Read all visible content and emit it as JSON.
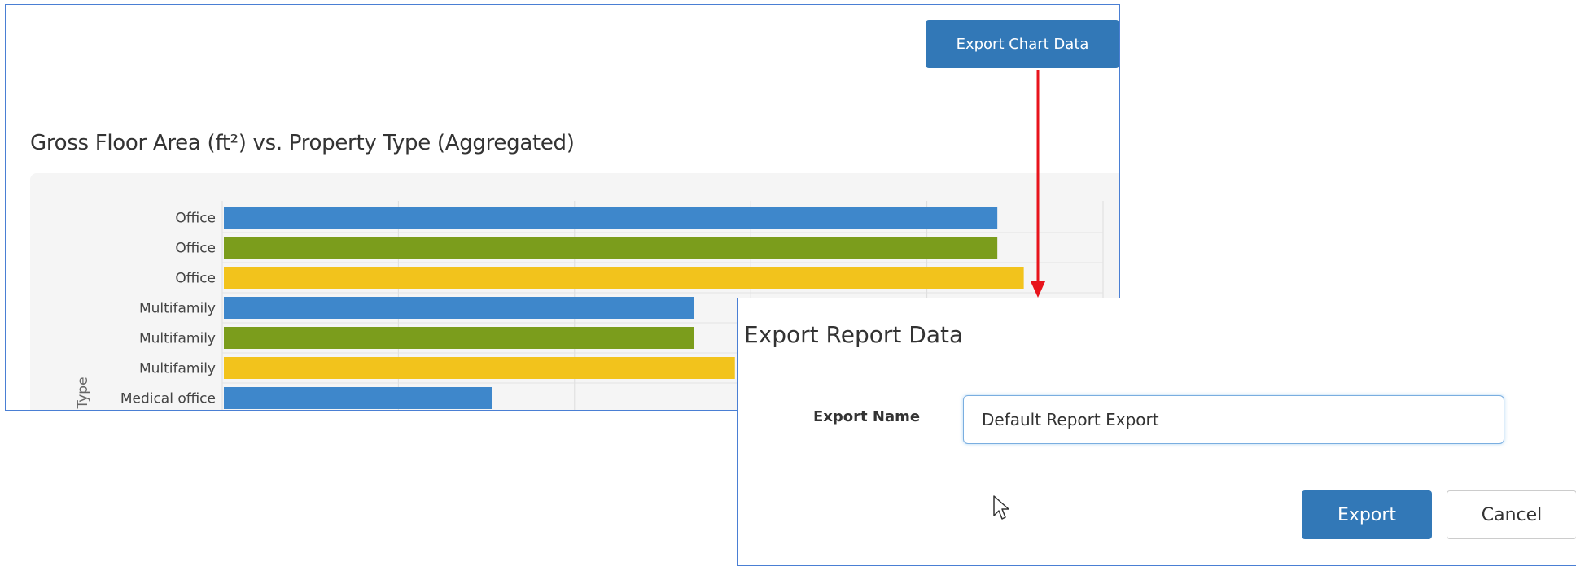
{
  "toolbar": {
    "export_chart_label": "Export Chart Data"
  },
  "chart_data": {
    "type": "bar",
    "orientation": "horizontal",
    "title": "Gross Floor Area (ft²) vs. Property Type (Aggregated)",
    "ylabel": "Type",
    "xlabel": "",
    "grid": true,
    "xlim": [
      0,
      5000
    ],
    "categories": [
      "Office",
      "Office",
      "Office",
      "Multifamily",
      "Multifamily",
      "Multifamily",
      "Medical office"
    ],
    "values": [
      4400,
      4400,
      4550,
      2680,
      2680,
      2910,
      1530
    ],
    "bar_colors": [
      "#3e87cb",
      "#7b9d1c",
      "#f2c31c",
      "#3e87cb",
      "#7b9d1c",
      "#f2c31c",
      "#3e87cb"
    ]
  },
  "dialog": {
    "title": "Export Report Data",
    "name_label": "Export Name",
    "name_value": "Default Report Export",
    "export_label": "Export",
    "cancel_label": "Cancel"
  },
  "colors": {
    "accent": "#3278b7",
    "arrow": "#e8141c",
    "focus_border": "#66afe9"
  },
  "icons": {
    "pointer": "mouse-pointer-icon"
  }
}
